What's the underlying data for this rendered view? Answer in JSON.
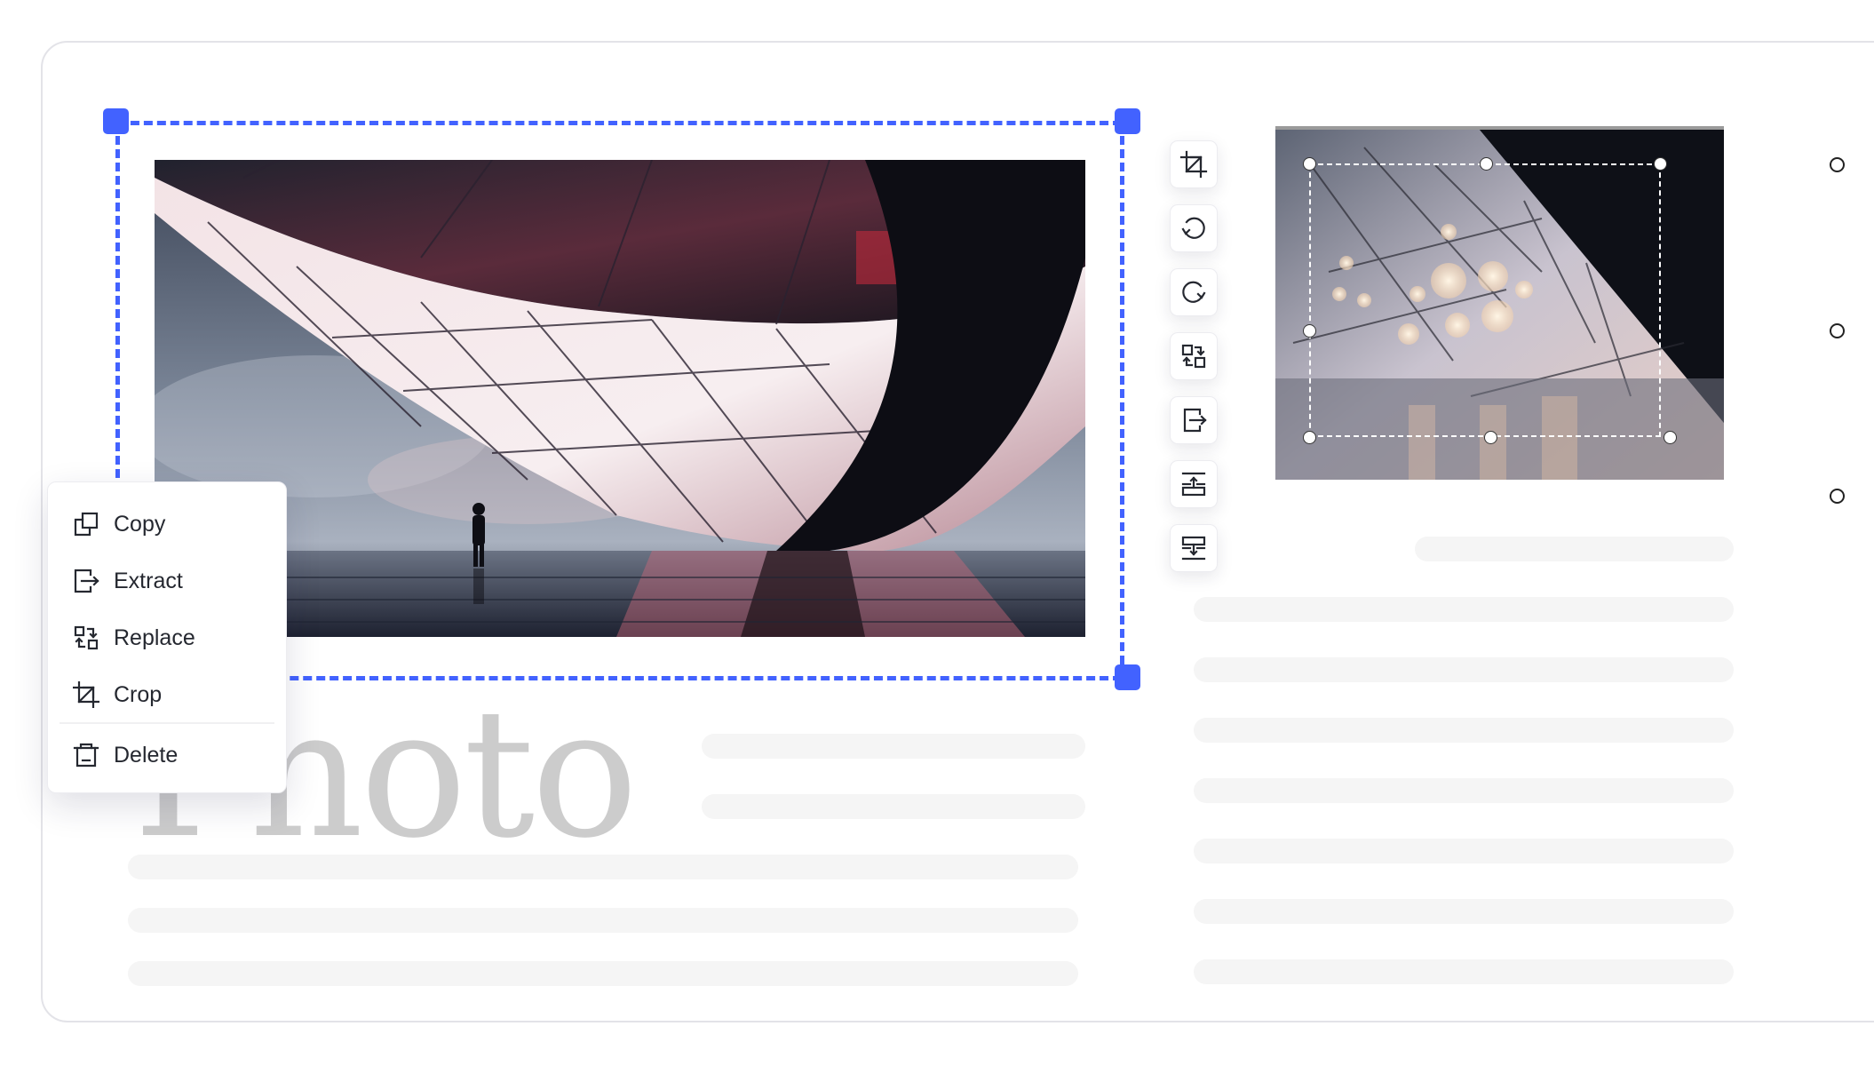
{
  "canvas": {
    "title_text": "Photo",
    "accent_color": "#4262ff"
  },
  "selected_image": {
    "description": "Futuristic faceted architecture over water with silhouette of a person",
    "state": "selected"
  },
  "image_toolbar": {
    "buttons": [
      {
        "id": "crop",
        "icon": "crop-icon",
        "label": "Crop"
      },
      {
        "id": "rotate-left",
        "icon": "rotate-left-icon",
        "label": "Rotate left"
      },
      {
        "id": "rotate-right",
        "icon": "rotate-right-icon",
        "label": "Rotate right"
      },
      {
        "id": "replace",
        "icon": "replace-icon",
        "label": "Replace"
      },
      {
        "id": "extract",
        "icon": "extract-icon",
        "label": "Extract"
      },
      {
        "id": "move-up",
        "icon": "align-top-icon",
        "label": "Move up"
      },
      {
        "id": "move-down",
        "icon": "align-bottom-icon",
        "label": "Move down"
      }
    ]
  },
  "crop_preview": {
    "description": "Faceted glass interior with bokeh lights, crop region active"
  },
  "context_menu": {
    "items": [
      {
        "id": "copy",
        "label": "Copy",
        "icon": "copy-icon"
      },
      {
        "id": "extract",
        "label": "Extract",
        "icon": "extract-icon"
      },
      {
        "id": "replace",
        "label": "Replace",
        "icon": "replace-icon"
      },
      {
        "id": "crop",
        "label": "Crop",
        "icon": "crop-icon"
      },
      {
        "id": "delete",
        "label": "Delete",
        "icon": "trash-icon"
      }
    ]
  },
  "options": {
    "radio_count": 3
  }
}
